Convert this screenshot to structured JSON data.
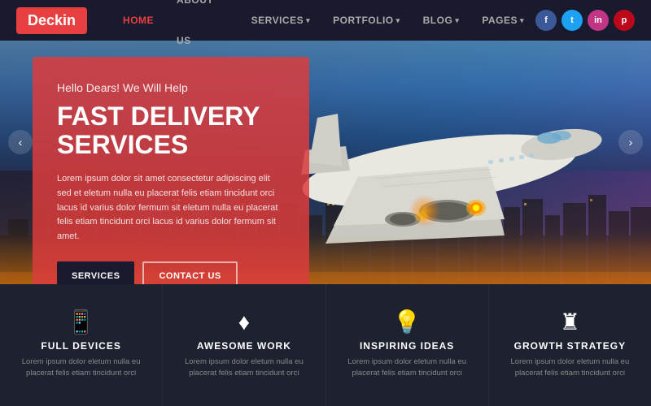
{
  "logo": {
    "text": "Deckin"
  },
  "nav": {
    "items": [
      {
        "label": "HOME",
        "active": true,
        "has_arrow": false
      },
      {
        "label": "ABOUT US",
        "active": false,
        "has_arrow": false
      },
      {
        "label": "SERVICES",
        "active": false,
        "has_arrow": true
      },
      {
        "label": "PORTFOLIO",
        "active": false,
        "has_arrow": true
      },
      {
        "label": "BLOG",
        "active": false,
        "has_arrow": true
      },
      {
        "label": "PAGES",
        "active": false,
        "has_arrow": true
      }
    ]
  },
  "social": [
    {
      "name": "facebook",
      "letter": "f",
      "class": "social-fb"
    },
    {
      "name": "twitter",
      "letter": "t",
      "class": "social-tw"
    },
    {
      "name": "instagram",
      "letter": "in",
      "class": "social-ig"
    },
    {
      "name": "pinterest",
      "letter": "p",
      "class": "social-pt"
    }
  ],
  "hero": {
    "subtitle": "Hello Dears! We Will Help",
    "title_line1": "FAST DELIVERY",
    "title_line2": "SERVICES",
    "description": "Lorem ipsum dolor sit amet consectetur adipiscing elit sed et eletum nulla eu placerat felis etiam tincidunt orci lacus id varius dolor fermum sit eletum nulla eu placerat felis etiam tincidunt orci lacus id varius dolor fermum sit amet.",
    "btn_services": "SERVICES",
    "btn_contact": "CONTACT US"
  },
  "features": [
    {
      "icon": "📱",
      "title": "FULL DEVICES",
      "desc": "Lorem ipsum dolor eletum nulla eu placerat felis etiam tincidunt orci"
    },
    {
      "icon": "💎",
      "title": "AWESOME WORK",
      "desc": "Lorem ipsum dolor eletum nulla eu placerat felis etiam tincidunt orci"
    },
    {
      "icon": "💡",
      "title": "INSPIRING IDEAS",
      "desc": "Lorem ipsum dolor eletum nulla eu placerat felis etiam tincidunt orci"
    },
    {
      "icon": "🏰",
      "title": "GROWTH STRATEGY",
      "desc": "Lorem ipsum dolor eletum nulla eu placerat felis etiam tincidunt orci"
    }
  ],
  "arrows": {
    "left": "‹",
    "right": "›"
  }
}
